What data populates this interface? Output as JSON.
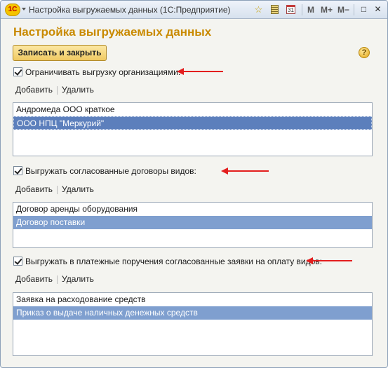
{
  "window": {
    "title": "Настройка выгружаемых данных  (1С:Предприятие)",
    "logo_text": "1С",
    "toolbar": {
      "m": "M",
      "m_plus": "M+",
      "m_minus": "M−",
      "calendar_day": "31"
    }
  },
  "form": {
    "title": "Настройка выгружаемых данных",
    "save_close_label": "Записать и закрыть",
    "help_label": "?"
  },
  "sections": [
    {
      "checkbox_label": "Ограничивать выгрузку организациями:",
      "checked": true,
      "add_label": "Добавить",
      "delete_label": "Удалить",
      "items": [
        "Андромеда ООО краткое",
        "ООО НПЦ \"Меркурий\""
      ],
      "selected_index": 1
    },
    {
      "checkbox_label": "Выгружать согласованные договоры видов:",
      "checked": true,
      "add_label": "Добавить",
      "delete_label": "Удалить",
      "items": [
        "Договор аренды оборудования",
        "Договор поставки"
      ],
      "selected_index": 1
    },
    {
      "checkbox_label": "Выгружать в платежные поручения согласованные заявки на оплату видов:",
      "checked": true,
      "add_label": "Добавить",
      "delete_label": "Удалить",
      "items": [
        "Заявка на расходование средств",
        "Приказ о выдаче наличных денежных средств"
      ],
      "selected_index": 1
    }
  ],
  "colors": {
    "title": "#c98a00",
    "selection": "#5c7fbc",
    "arrow": "#e31e1e"
  }
}
